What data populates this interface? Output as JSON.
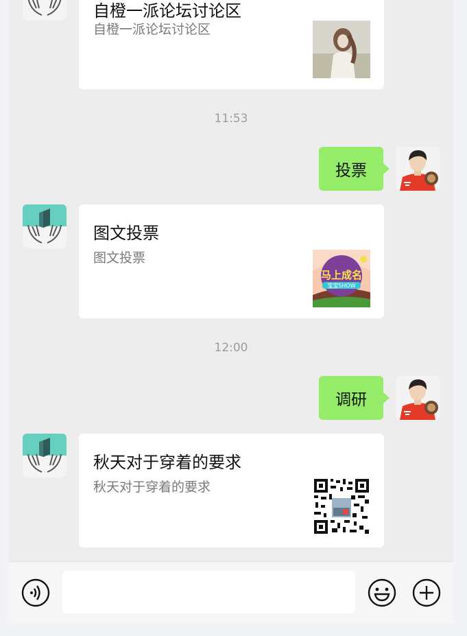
{
  "messages": [
    {
      "type": "article",
      "title": "自橙一派论坛讨论区",
      "desc": "自橙一派论坛讨论区",
      "thumb": "girl-photo-thumbnail"
    },
    {
      "type": "time",
      "text": "11:53"
    },
    {
      "type": "text_out",
      "text": "投票"
    },
    {
      "type": "article",
      "title": "图文投票",
      "desc": "图文投票",
      "thumb": "show-poster-thumbnail",
      "thumb_text": "马上成名",
      "thumb_sub": "宝宝SHOW"
    },
    {
      "type": "time",
      "text": "12:00"
    },
    {
      "type": "text_out",
      "text": "调研"
    },
    {
      "type": "article",
      "title": "秋天对于穿着的要求",
      "desc": "秋天对于穿着的要求",
      "thumb": "qr-code-thumbnail"
    }
  ],
  "input_bar": {
    "voice_icon": "voice-icon",
    "emoji_icon": "emoji-icon",
    "plus_icon": "plus-icon",
    "input_value": ""
  },
  "colors": {
    "chat_bg": "#ededed",
    "bubble_out": "#95ec69",
    "card_bg": "#ffffff",
    "avatar_teal": "#66cfc0"
  }
}
